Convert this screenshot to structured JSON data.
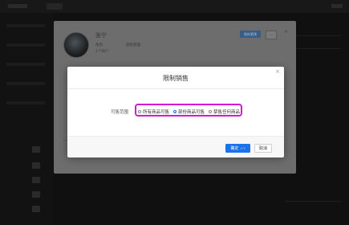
{
  "dialog": {
    "user_name": "张宁",
    "meta_label_1": "角色",
    "meta_value_1": "超级管理",
    "meta_label_2": "1个商户",
    "primary_button": "保存更改",
    "more_button": "…",
    "close_icon": "close-icon"
  },
  "modal": {
    "title": "限制销售",
    "close_glyph": "×",
    "field_label": "可售范围",
    "options": [
      {
        "label": "所有商品可售",
        "checked": false
      },
      {
        "label": "部份商品可售",
        "checked": true
      },
      {
        "label": "禁售任何商品",
        "checked": false
      }
    ],
    "ok_label": "确定",
    "ok_hint": "⏎ Y",
    "cancel_label": "取消"
  },
  "colors": {
    "primary": "#1a73e8",
    "highlight": "#d21ad2"
  }
}
